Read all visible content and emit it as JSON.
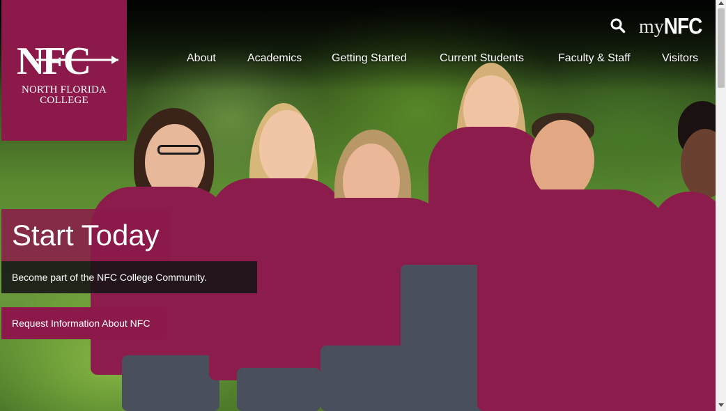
{
  "logo": {
    "mark": "NFC",
    "line1": "NORTH FLORIDA",
    "line2": "COLLEGE"
  },
  "header": {
    "search_icon": "search-icon",
    "mynfc_prefix": "my",
    "mynfc_suffix": "NFC"
  },
  "nav": {
    "items": [
      {
        "label": "About"
      },
      {
        "label": "Academics"
      },
      {
        "label": "Getting Started"
      },
      {
        "label": "Current Students"
      },
      {
        "label": "Faculty & Staff"
      },
      {
        "label": "Visitors"
      }
    ]
  },
  "hero": {
    "title": "Start Today",
    "subtitle": "Become part of the NFC College Community.",
    "button_label": "Request Information About NFC"
  },
  "colors": {
    "brand": "#8b1a4a",
    "text": "#ffffff"
  }
}
